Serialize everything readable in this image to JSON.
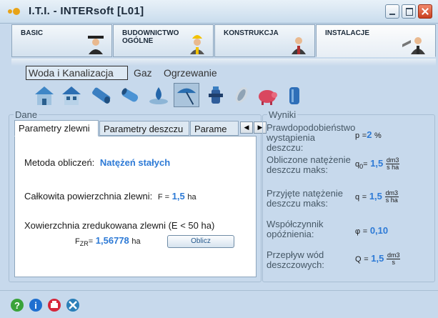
{
  "window": {
    "title": "I.T.I. - INTERsoft [L01]"
  },
  "main_tabs": [
    {
      "label": "BASIC",
      "active": false
    },
    {
      "label": "BUDOWNICTWO\nOGÓLNE",
      "active": false
    },
    {
      "label": "KONSTRUKCJA",
      "active": false
    },
    {
      "label": "INSTALACJE",
      "active": true
    }
  ],
  "sub_tabs": [
    {
      "label": "Woda i Kanalizacja",
      "active": true
    },
    {
      "label": "Gaz",
      "active": false
    },
    {
      "label": "Ogrzewanie",
      "active": false
    }
  ],
  "toolbar_icons": [
    "house-blue-icon",
    "house-roof-icon",
    "pipe-icon",
    "pipe-segment-icon",
    "water-drop-icon",
    "umbrella-icon",
    "hydrant-icon",
    "pipe-cut-icon",
    "pig-icon",
    "tank-icon"
  ],
  "dane": {
    "legend": "Dane",
    "tabs": [
      {
        "label": "Parametry zlewni",
        "active": true
      },
      {
        "label": "Parametry deszczu",
        "active": false
      },
      {
        "label": "Parame",
        "active": false
      }
    ],
    "method_label": "Metoda obliczeń:",
    "method_value": "Natężeń stałych",
    "area_label": "Całkowita powierzchnia zlewni:",
    "area_symbol": "F =",
    "area_value": "1,5",
    "area_unit": "ha",
    "reduced_label": "Xowierzchnia zredukowana zlewni (E < 50 ha)",
    "reduced_symbol": "F",
    "reduced_subscript": "ZR",
    "reduced_eq": "=",
    "reduced_value": "1,56778",
    "reduced_unit": "ha",
    "calc_button": "Oblicz"
  },
  "wyniki": {
    "legend": "Wyniki",
    "rows": [
      {
        "label": "Prawdopodobieństwo wystąpienia deszczu:",
        "symbol": "p",
        "sub": "",
        "eq": "=",
        "value": "2",
        "unit": "%",
        "unit_num": "",
        "unit_den": ""
      },
      {
        "label": "Obliczone natężenie deszczu maks:",
        "symbol": "q",
        "sub": "0",
        "eq": "=",
        "value": "1,5",
        "unit": "",
        "unit_num": "dm3",
        "unit_den": "s ha"
      },
      {
        "label": "Przyjęte natężenie deszczu maks:",
        "symbol": "q",
        "sub": "",
        "eq": "=",
        "value": "1,5",
        "unit": "",
        "unit_num": "dm3",
        "unit_den": "s ha"
      },
      {
        "label": "Współczynnik opóźnienia:",
        "symbol": "φ",
        "sub": "",
        "eq": "=",
        "value": "0,10",
        "unit": "",
        "unit_num": "",
        "unit_den": ""
      },
      {
        "label": "Przepływ wód deszczowych:",
        "symbol": "Q",
        "sub": "",
        "eq": "=",
        "value": "1,5",
        "unit": "",
        "unit_num": "dm3",
        "unit_den": "s"
      }
    ]
  },
  "statusbar_icons": [
    "help-icon",
    "info-icon",
    "print-icon",
    "tools-icon"
  ],
  "colors": {
    "accent_blue": "#2d7ad6",
    "background": "#c7d9ec",
    "close_red": "#c8401f"
  }
}
